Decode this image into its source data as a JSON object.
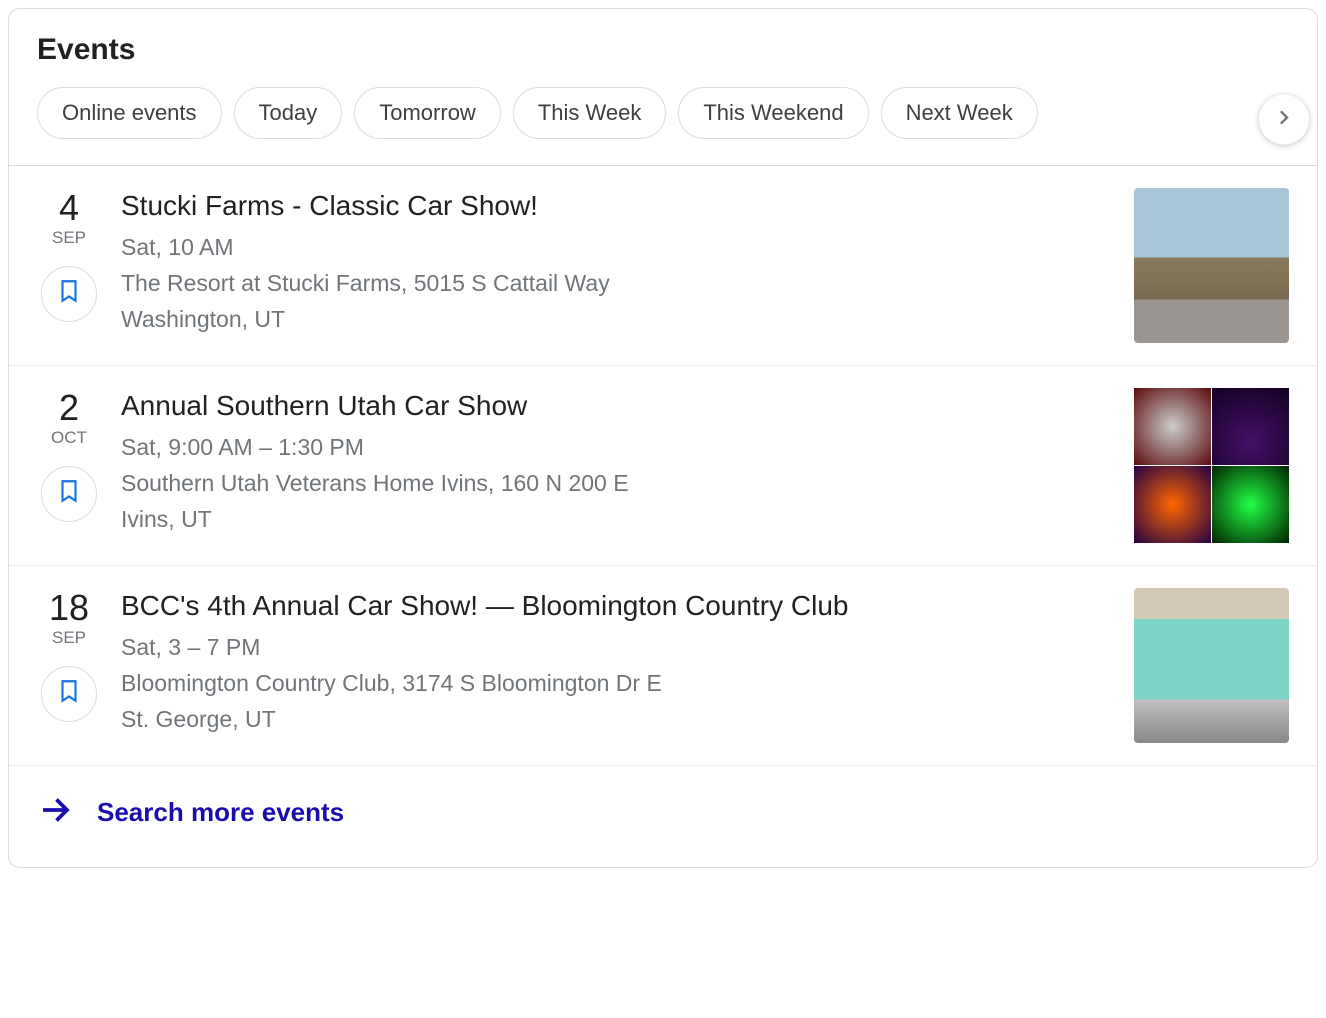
{
  "header": {
    "title": "Events"
  },
  "filters": [
    "Online events",
    "Today",
    "Tomorrow",
    "This Week",
    "This Weekend",
    "Next Week"
  ],
  "events": [
    {
      "day": "4",
      "month": "SEP",
      "title": "Stucki Farms - Classic Car Show!",
      "time": "Sat, 10 AM",
      "address": "The Resort at Stucki Farms, 5015 S Cattail Way",
      "city": "Washington, UT"
    },
    {
      "day": "2",
      "month": "OCT",
      "title": "Annual Southern Utah Car Show",
      "time": "Sat, 9:00 AM – 1:30 PM",
      "address": "Southern Utah Veterans Home Ivins, 160 N 200 E",
      "city": "Ivins, UT"
    },
    {
      "day": "18",
      "month": "SEP",
      "title": "BCC's 4th Annual Car Show! — Bloomington Country Club",
      "time": "Sat, 3 – 7 PM",
      "address": "Bloomington Country Club, 3174 S Bloomington Dr E",
      "city": "St. George, UT"
    }
  ],
  "footer": {
    "search_more_label": "Search more events"
  }
}
